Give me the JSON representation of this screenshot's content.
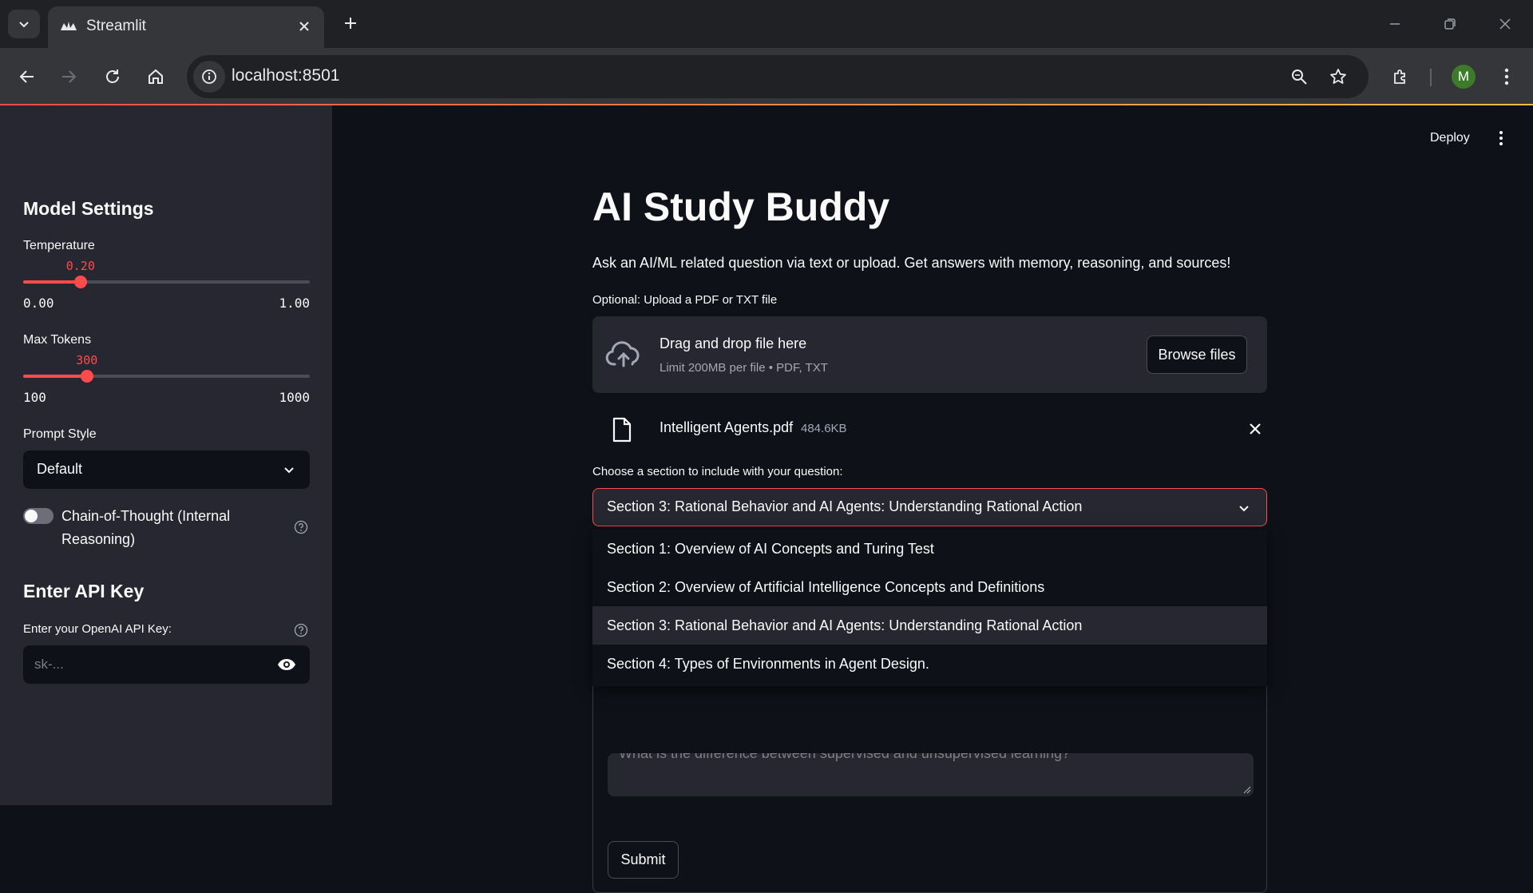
{
  "browser": {
    "tab_title": "Streamlit",
    "url": "localhost:8501",
    "profile_initial": "M"
  },
  "header": {
    "deploy_label": "Deploy"
  },
  "sidebar": {
    "model_settings_title": "Model Settings",
    "temperature": {
      "label": "Temperature",
      "value": 0.2,
      "value_text": "0.20",
      "min_text": "0.00",
      "max_text": "1.00",
      "min": 0,
      "max": 1
    },
    "max_tokens": {
      "label": "Max Tokens",
      "value": 300,
      "value_text": "300",
      "min_text": "100",
      "max_text": "1000",
      "min": 100,
      "max": 1000
    },
    "prompt_style": {
      "label": "Prompt Style",
      "selected": "Default"
    },
    "cot_toggle": {
      "label": "Chain-of-Thought (Internal Reasoning)",
      "on": false
    },
    "api_title": "Enter API Key",
    "api_label": "Enter your OpenAI API Key:",
    "api_placeholder": "sk-..."
  },
  "main": {
    "title": "AI Study Buddy",
    "description": "Ask an AI/ML related question via text or upload. Get answers with memory, reasoning, and sources!",
    "upload_label": "Optional: Upload a PDF or TXT file",
    "dropzone_title": "Drag and drop file here",
    "dropzone_limit": "Limit 200MB per file • PDF, TXT",
    "browse_label": "Browse files",
    "file": {
      "name": "Intelligent Agents.pdf",
      "size": "484.6KB"
    },
    "section_label": "Choose a section to include with your question:",
    "section_selected": "Section 3: Rational Behavior and AI Agents: Understanding Rational Action",
    "section_options": [
      "Section 1: Overview of AI Concepts and Turing Test",
      "Section 2: Overview of Artificial Intelligence Concepts and Definitions",
      "Section 3: Rational Behavior and AI Agents: Understanding Rational Action",
      "Section 4: Types of Environments in Agent Design."
    ],
    "question_partial": "What is the difference between supervised and unsupervised learning?",
    "submit_label": "Submit"
  },
  "colors": {
    "accent": "#ff4b4b",
    "background": "#0e1117",
    "sidebar_bg": "#262730"
  }
}
